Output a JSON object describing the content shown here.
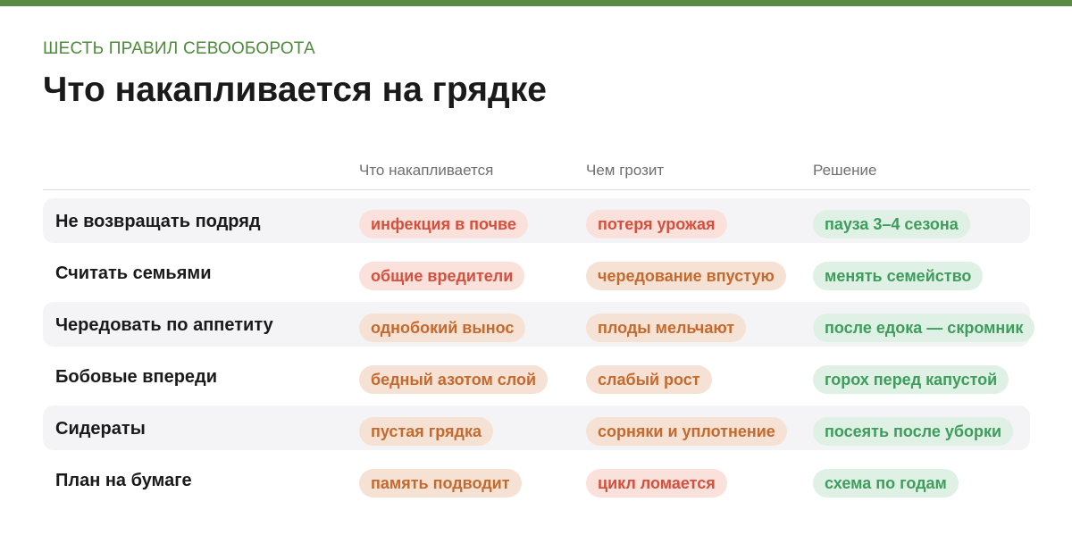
{
  "header": {
    "eyebrow": "ШЕСТЬ ПРАВИЛ СЕВООБОРОТА",
    "title": "Что накапливается на грядке"
  },
  "columns": [
    "Что накапливается",
    "Чем грозит",
    "Решение"
  ],
  "colors": {
    "accent_green": "#5a8a44",
    "red_text": "#d64f3c",
    "red_bg": "#fbe1dc",
    "orange_text": "#c46a2e",
    "orange_bg": "#f6e2d4",
    "green_text": "#3e9d5c",
    "green_bg": "#dff1e4"
  },
  "rows": [
    {
      "rule": "Не возвращать подряд",
      "accumulates": "инфекция в почве",
      "accumulates_tone": "red",
      "threat": "потеря урожая",
      "threat_tone": "red",
      "solution": "пауза 3–4 сезона"
    },
    {
      "rule": "Считать семьями",
      "accumulates": "общие вредители",
      "accumulates_tone": "red",
      "threat": "чередование впустую",
      "threat_tone": "orange",
      "solution": "менять семейство"
    },
    {
      "rule": "Чередовать по аппетиту",
      "accumulates": "однобокий вынос",
      "accumulates_tone": "orange",
      "threat": "плоды мельчают",
      "threat_tone": "orange",
      "solution": "после едока — скромник"
    },
    {
      "rule": "Бобовые впереди",
      "accumulates": "бедный азотом слой",
      "accumulates_tone": "orange",
      "threat": "слабый рост",
      "threat_tone": "orange",
      "solution": "горох перед капустой"
    },
    {
      "rule": "Сидераты",
      "accumulates": "пустая грядка",
      "accumulates_tone": "orange",
      "threat": "сорняки и уплотнение",
      "threat_tone": "orange",
      "solution": "посеять после уборки"
    },
    {
      "rule": "План на бумаге",
      "accumulates": "память подводит",
      "accumulates_tone": "orange",
      "threat": "цикл ломается",
      "threat_tone": "red",
      "solution": "схема по годам"
    }
  ]
}
